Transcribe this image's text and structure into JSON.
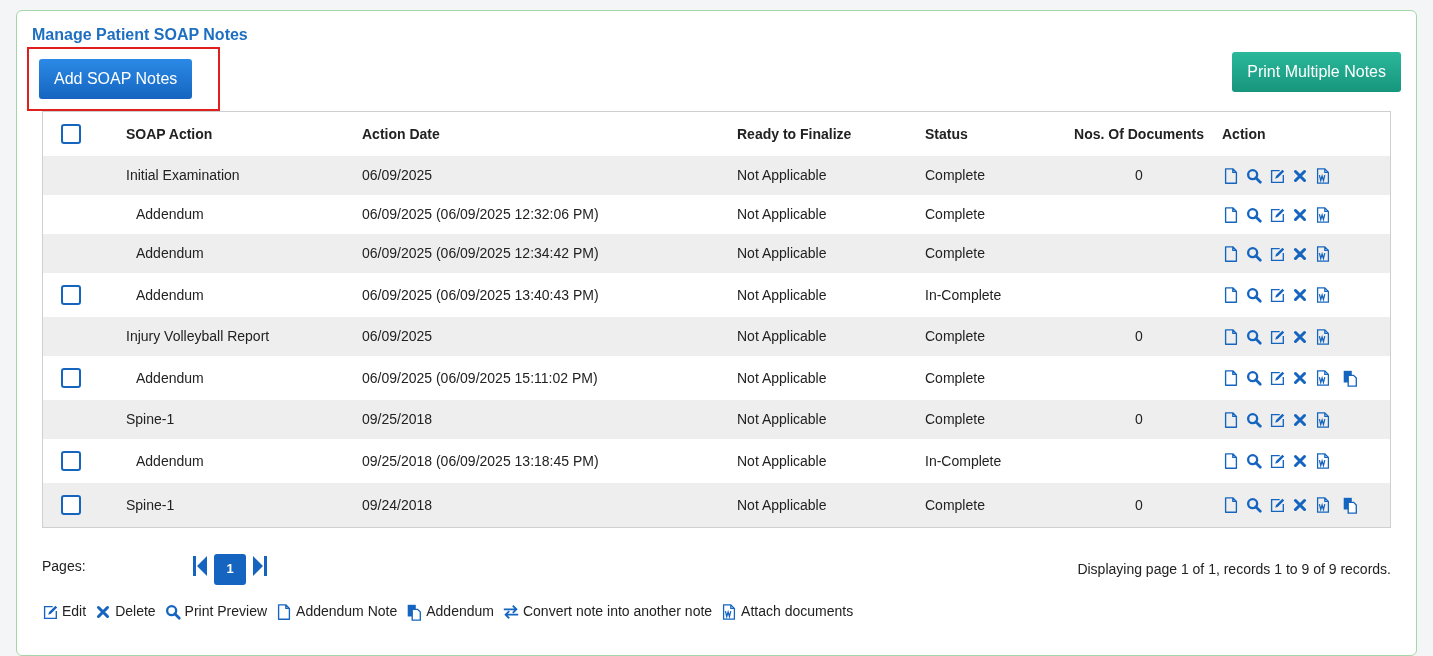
{
  "title": "Manage Patient SOAP Notes",
  "add_button": {
    "label": "Add SOAP Notes",
    "highlighted": true
  },
  "print_button": {
    "label": "Print Multiple Notes"
  },
  "table": {
    "header_checkbox": {
      "checked": false
    },
    "columns": [
      "SOAP Action",
      "Action Date",
      "Ready to Finalize",
      "Status",
      "Nos. Of Documents",
      "Action"
    ],
    "rows": [
      {
        "soap_action": "Initial Examination",
        "action_date": "06/09/2025",
        "ready": "Not Applicable",
        "status": "Complete",
        "documents": "0",
        "addendum_icon": false,
        "children": [
          {
            "soap_action": "Addendum",
            "action_date": "06/09/2025 (06/09/2025 12:32:06 PM)",
            "ready": "Not Applicable",
            "status": "Complete",
            "addendum_icon": false
          },
          {
            "soap_action": "Addendum",
            "action_date": "06/09/2025 (06/09/2025 12:34:42 PM)",
            "ready": "Not Applicable",
            "status": "Complete",
            "addendum_icon": false
          },
          {
            "soap_action": "Addendum",
            "action_date": "06/09/2025 (06/09/2025 13:40:43 PM)",
            "ready": "Not Applicable",
            "status": "In-Complete",
            "addendum_icon": false,
            "checkbox": {
              "checked": false
            }
          }
        ]
      },
      {
        "soap_action": "Injury Volleyball Report",
        "action_date": "06/09/2025",
        "ready": "Not Applicable",
        "status": "Complete",
        "documents": "0",
        "addendum_icon": false,
        "children": [
          {
            "soap_action": "Addendum",
            "action_date": "06/09/2025 (06/09/2025 15:11:02 PM)",
            "ready": "Not Applicable",
            "status": "Complete",
            "addendum_icon": true,
            "checkbox": {
              "checked": false
            }
          }
        ]
      },
      {
        "soap_action": "Spine-1",
        "action_date": "09/25/2018",
        "ready": "Not Applicable",
        "status": "Complete",
        "documents": "0",
        "addendum_icon": false,
        "children": [
          {
            "soap_action": "Addendum",
            "action_date": "09/25/2018 (06/09/2025 13:18:45 PM)",
            "ready": "Not Applicable",
            "status": "In-Complete",
            "addendum_icon": false,
            "checkbox": {
              "checked": false
            }
          }
        ]
      },
      {
        "soap_action": "Spine-1",
        "action_date": "09/24/2018",
        "ready": "Not Applicable",
        "status": "Complete",
        "documents": "0",
        "addendum_icon": true,
        "checkbox": {
          "checked": false
        }
      }
    ]
  },
  "pagination": {
    "label": "Pages:",
    "pages": [
      {
        "label": "1",
        "selected": true
      }
    ],
    "summary": "Displaying page 1 of 1, records 1 to 9 of 9 records."
  },
  "legend": [
    {
      "kind": "edit",
      "label": "Edit"
    },
    {
      "kind": "delete",
      "label": "Delete"
    },
    {
      "kind": "preview",
      "label": "Print Preview"
    },
    {
      "kind": "note",
      "label": "Addendum Note"
    },
    {
      "kind": "addendum",
      "label": "Addendum"
    },
    {
      "kind": "convert",
      "label": "Convert note into another note"
    },
    {
      "kind": "attach",
      "label": "Attach documents"
    }
  ]
}
